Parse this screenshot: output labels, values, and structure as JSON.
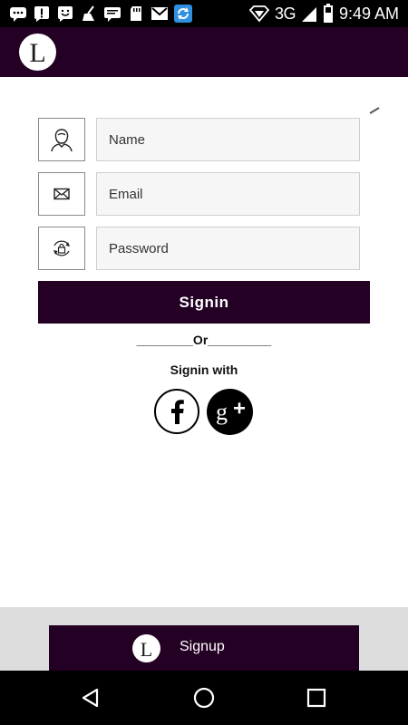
{
  "status_bar": {
    "network": "3G",
    "time": "9:49 AM",
    "left_icons": [
      "chat-bubble-icon",
      "alert-icon",
      "smiley-icon",
      "broom-icon",
      "message-icon",
      "sd-card-icon",
      "gmail-icon",
      "sync-icon"
    ],
    "right_icons": [
      "wifi-hotspot-icon",
      "signal-icon",
      "battery-icon"
    ]
  },
  "header": {
    "logo_letter": "L"
  },
  "form": {
    "name_placeholder": "Name",
    "email_placeholder": "Email",
    "password_placeholder": "Password",
    "name_icon": "user-icon",
    "email_icon": "envelope-icon",
    "password_icon": "lock-icon"
  },
  "signin": {
    "label": "Signin"
  },
  "divider": {
    "text": "________Or_________"
  },
  "social": {
    "label": "Signin with",
    "facebook_glyph": "f",
    "google_glyph": "g+"
  },
  "signup": {
    "logo_letter": "L",
    "label": "Signup"
  },
  "colors": {
    "brand": "#240024",
    "input_bg": "#f6f6f7",
    "bottom_bg": "#dcdcdc"
  }
}
